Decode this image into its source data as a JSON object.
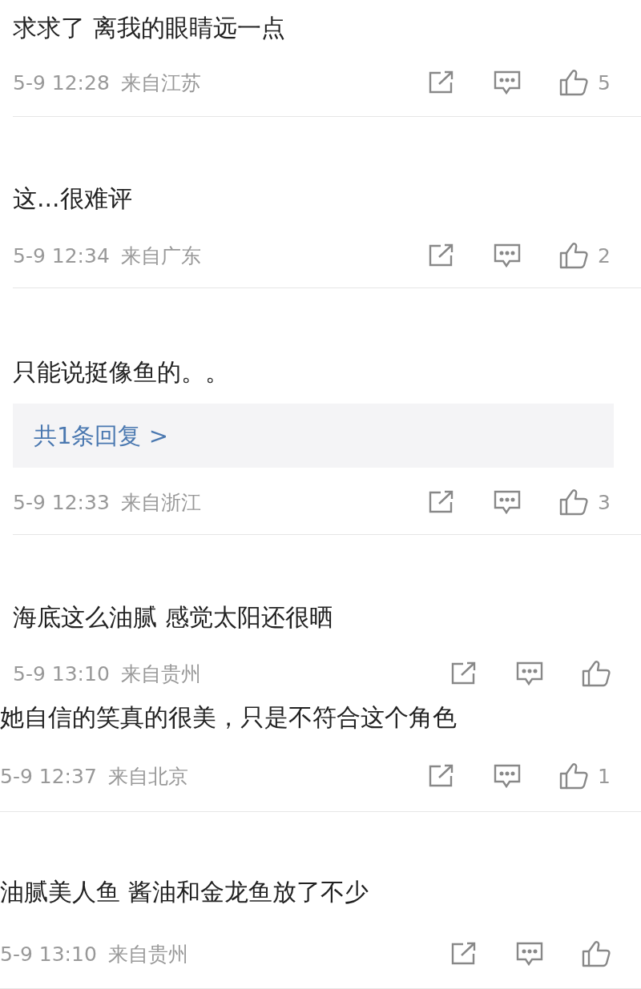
{
  "comments": [
    {
      "text": "求求了 离我的眼睛远一点",
      "time": "5-9 12:28",
      "location": "来自江苏",
      "likes": "5"
    },
    {
      "text": "这...很难评",
      "time": "5-9 12:34",
      "location": "来自广东",
      "likes": "2"
    },
    {
      "text": "只能说挺像鱼的。。",
      "reply": "共1条回复 >",
      "time": "5-9 12:33",
      "location": "来自浙江",
      "likes": "3"
    },
    {
      "text": "海底这么油腻 感觉太阳还很晒",
      "time": "5-9 13:10",
      "location": "来自贵州"
    },
    {
      "text": "她自信的笑真的很美，只是不符合这个角色",
      "time": "5-9 12:37",
      "location": "来自北京",
      "likes": "1"
    },
    {
      "text": "油腻美人鱼 酱油和金龙鱼放了不少",
      "time": "5-9 13:10",
      "location": "来自贵州"
    }
  ]
}
